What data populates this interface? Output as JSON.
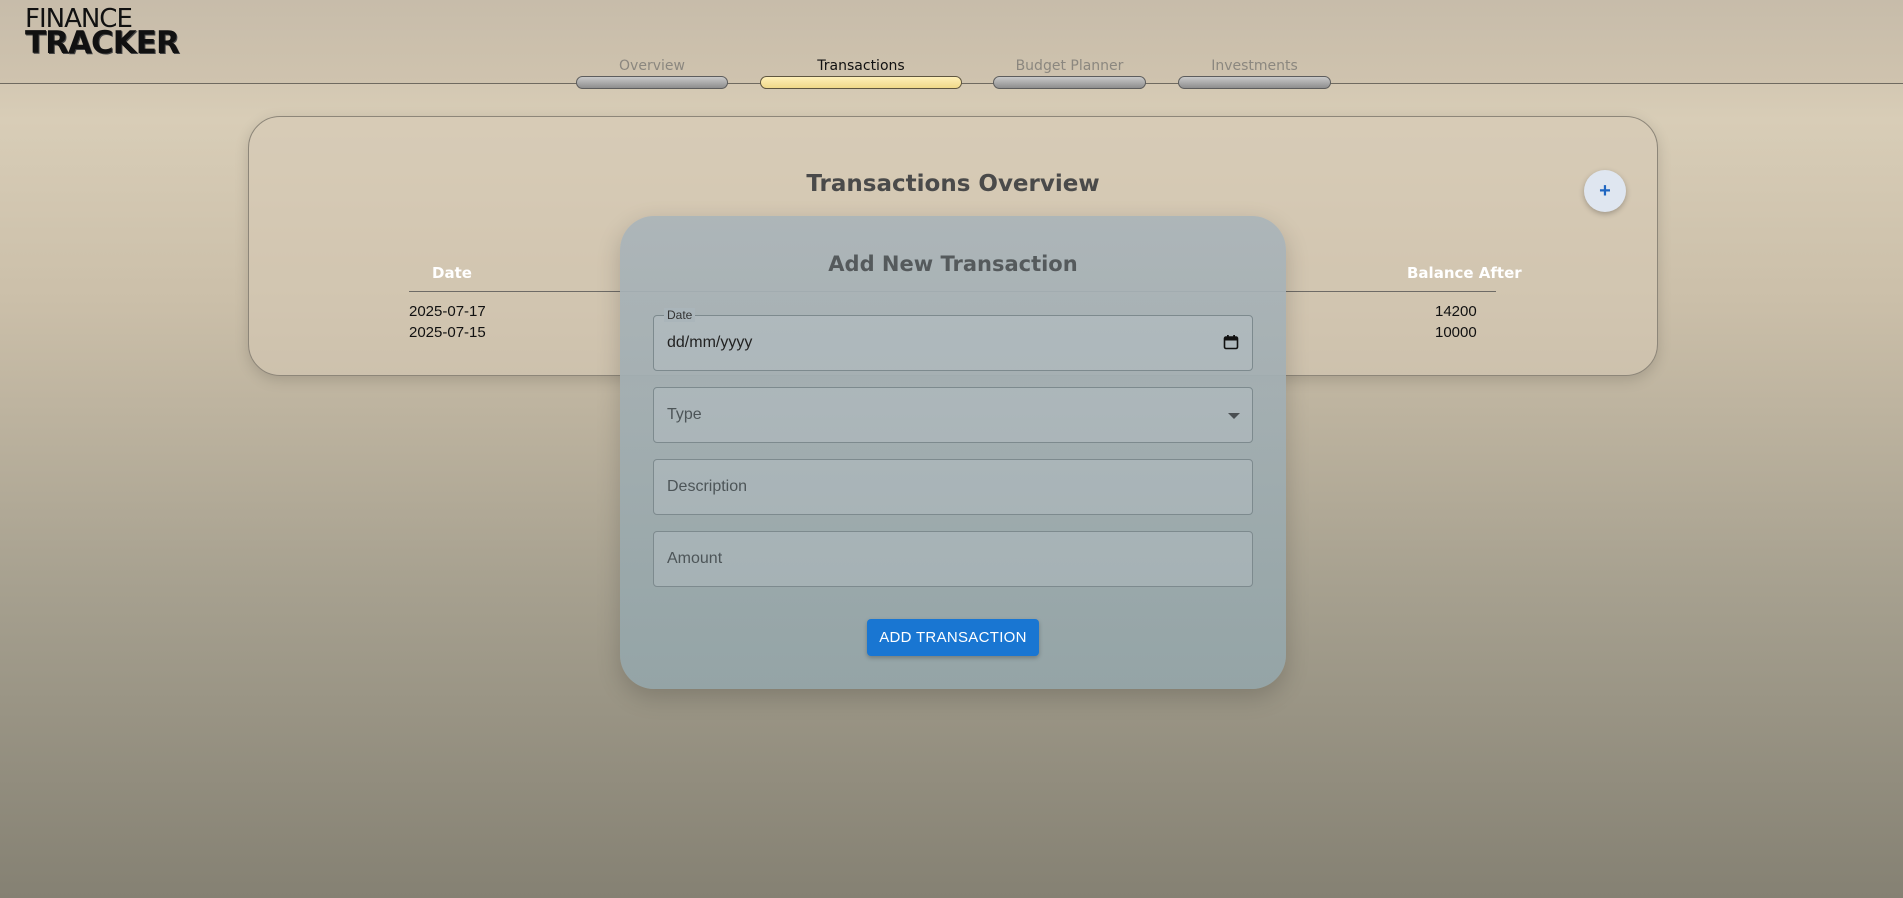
{
  "app": {
    "logo_line1": "FINANCE",
    "logo_line2": "TRACKER"
  },
  "nav": {
    "tabs": [
      {
        "label": "Overview",
        "active": false
      },
      {
        "label": "Transactions",
        "active": true
      },
      {
        "label": "Budget Planner",
        "active": false
      },
      {
        "label": "Investments",
        "active": false
      }
    ]
  },
  "transactions": {
    "title": "Transactions Overview",
    "add_button_icon": "plus-icon",
    "add_button_glyph": "+",
    "columns": [
      "Date",
      "Balance After"
    ],
    "rows": [
      {
        "date": "2025-07-17",
        "balance_after": "14200"
      },
      {
        "date": "2025-07-15",
        "balance_after": "10000"
      }
    ]
  },
  "modal": {
    "title": "Add New Transaction",
    "date_label": "Date",
    "date_value": "dd/mm/yyyy",
    "type_placeholder": "Type",
    "description_placeholder": "Description",
    "amount_placeholder": "Amount",
    "submit_label": "ADD TRANSACTION"
  },
  "colors": {
    "accent": "#1976d2",
    "active_tab": "#f0d98a"
  }
}
